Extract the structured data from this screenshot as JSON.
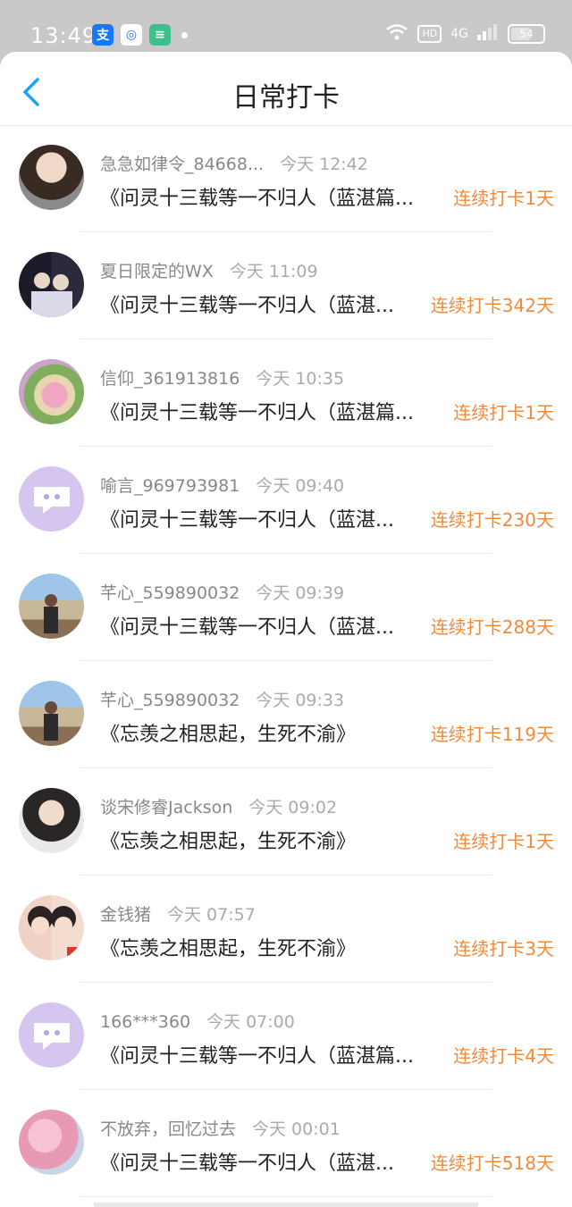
{
  "status": {
    "time": "13:49",
    "battery": "54",
    "network": "4G"
  },
  "header": {
    "title": "日常打卡"
  },
  "rows": [
    {
      "name": "急急如律令_84668...",
      "time": "今天 12:42",
      "content": "《问灵十三载等一不归人（蓝湛篇...",
      "streak": "连续打卡1天",
      "avatar": "photo-girl"
    },
    {
      "name": "夏日限定的WX",
      "time": "今天 11:09",
      "content": "《问灵十三载等一不归人（蓝湛...",
      "streak": "连续打卡342天",
      "avatar": "photo-duo"
    },
    {
      "name": "信仰_361913816",
      "time": "今天 10:35",
      "content": "《问灵十三载等一不归人（蓝湛篇...",
      "streak": "连续打卡1天",
      "avatar": "photo-flower"
    },
    {
      "name": "喻言_969793981",
      "time": "今天 09:40",
      "content": "《问灵十三载等一不归人（蓝湛...",
      "streak": "连续打卡230天",
      "avatar": "default"
    },
    {
      "name": "芊心_559890032",
      "time": "今天 09:39",
      "content": "《问灵十三载等一不归人（蓝湛...",
      "streak": "连续打卡288天",
      "avatar": "photo-beach"
    },
    {
      "name": "芊心_559890032",
      "time": "今天 09:33",
      "content": "《忘羡之相思起，生死不渝》",
      "streak": "连续打卡119天",
      "avatar": "photo-beach"
    },
    {
      "name": "谈宋修睿Jackson",
      "time": "今天 09:02",
      "content": "《忘羡之相思起，生死不渝》",
      "streak": "连续打卡1天",
      "avatar": "photo-boy"
    },
    {
      "name": "金钱猪",
      "time": "今天 07:57",
      "content": "《忘羡之相思起，生死不渝》",
      "streak": "连续打卡3天",
      "avatar": "photo-pair"
    },
    {
      "name": "166***360",
      "time": "今天 07:00",
      "content": "《问灵十三载等一不归人（蓝湛篇...",
      "streak": "连续打卡4天",
      "avatar": "default"
    },
    {
      "name": "不放弃，回忆过去",
      "time": "今天 00:01",
      "content": "《问灵十三载等一不归人（蓝湛...",
      "streak": "连续打卡518天",
      "avatar": "photo-blossom"
    }
  ],
  "colors": {
    "accent": "#f08a3c",
    "back": "#1aa3ff",
    "defaultAvatar": "#d5c6f0"
  }
}
